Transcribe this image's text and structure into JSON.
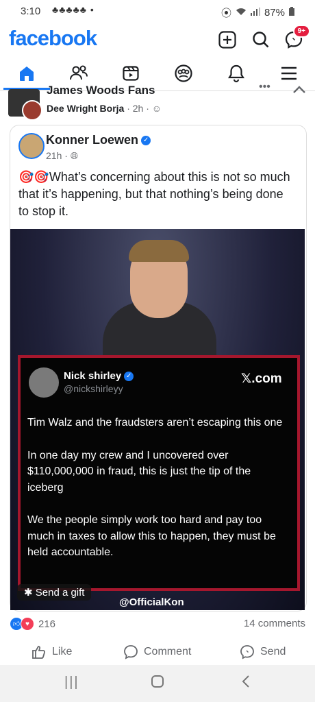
{
  "status_bar": {
    "time": "3:10",
    "notifications": "♣♣♣♣♣ •",
    "battery": "87%"
  },
  "header": {
    "logo": "facebook",
    "messenger_badge": "9+"
  },
  "previous_post": {
    "group": "James Woods Fans",
    "author": "Dee Wright Borja",
    "time": "2h",
    "more": "•••"
  },
  "post": {
    "author": "Konner Loewen",
    "time": "21h",
    "text": "🎯🎯What’s concerning about this is not so much that it’s happening, but that nothing’s being done to stop it."
  },
  "tweet": {
    "name": "Nick shirley",
    "handle": "@nickshirleyy",
    "source": "𝕏.com",
    "paragraphs": [
      "Tim Walz and the fraudsters aren’t escaping this one",
      "In one day my crew and I uncovered over $110,000,000 in fraud, this is just the tip of the iceberg",
      "We the people simply work too hard and pay too much in taxes to allow this to happen, they must be held accountable."
    ]
  },
  "overlay": {
    "gift_label": "Send a gift",
    "watermark": "@OfficialKon"
  },
  "reactions": {
    "count": "216",
    "comments": "14 comments"
  },
  "actions": {
    "like": "Like",
    "comment": "Comment",
    "send": "Send"
  },
  "colors": {
    "brand": "#1877f2",
    "tweet_border": "#a5172d"
  }
}
